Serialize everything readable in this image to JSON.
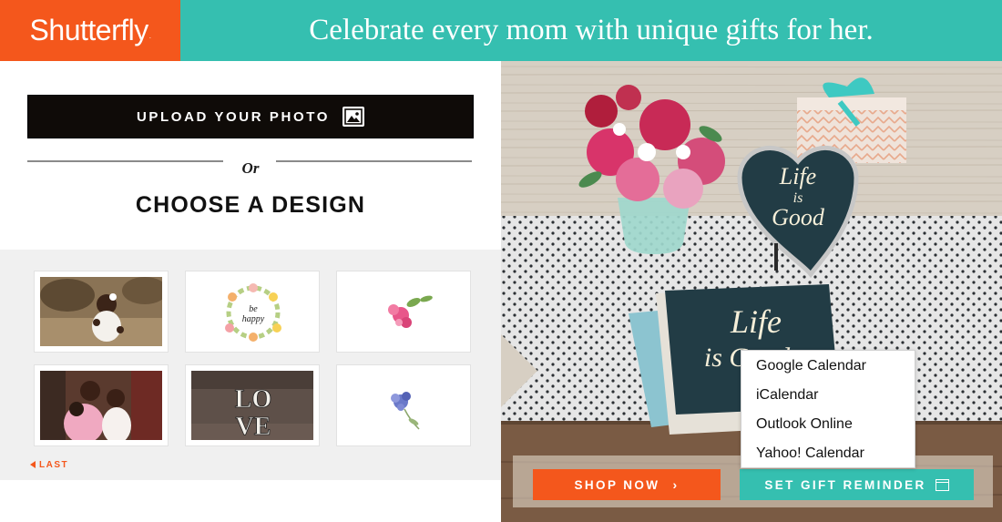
{
  "header": {
    "logo_text": "Shutterfly",
    "logo_mark": ".",
    "tagline": "Celebrate every mom with unique gifts for her."
  },
  "left_panel": {
    "upload_label": "UPLOAD YOUR PHOTO",
    "or_text": "Or",
    "choose_label": "CHOOSE A DESIGN",
    "thumbnails": [
      {
        "name": "photo-toddler"
      },
      {
        "name": "be-happy-wreath",
        "text": "be happy"
      },
      {
        "name": "pink-flower"
      },
      {
        "name": "photo-family"
      },
      {
        "name": "love-letters",
        "text": "LOVE"
      },
      {
        "name": "blue-flower"
      }
    ],
    "last_label": "LAST"
  },
  "hero": {
    "heart_text": "Life is Good",
    "book_text": "Life is Good",
    "shop_label": "SHOP NOW",
    "reminder_label": "SET GIFT REMINDER",
    "calendar_options": [
      "Google Calendar",
      "iCalendar",
      "Outlook Online",
      "Yahoo! Calendar"
    ]
  },
  "colors": {
    "brand_orange": "#f4571c",
    "brand_teal": "#35bfb0",
    "dark": "#0f0b08"
  }
}
